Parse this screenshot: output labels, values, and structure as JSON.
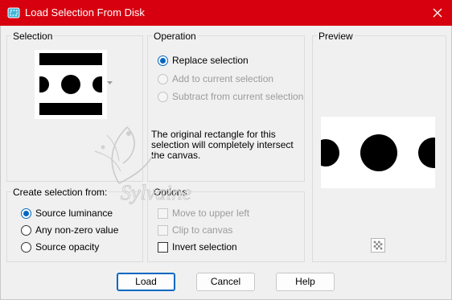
{
  "window": {
    "title": "Load Selection From Disk"
  },
  "selection": {
    "label": "Selection"
  },
  "operation": {
    "label": "Operation",
    "options": [
      {
        "label": "Replace selection",
        "checked": true,
        "disabled": false
      },
      {
        "label": "Add to current selection",
        "checked": false,
        "disabled": true
      },
      {
        "label": "Subtract from current selection",
        "checked": false,
        "disabled": true
      }
    ],
    "note": "The original rectangle for this selection will completely intersect the canvas."
  },
  "create_from": {
    "label": "Create selection from:",
    "options": [
      {
        "label": "Source luminance",
        "checked": true
      },
      {
        "label": "Any non-zero value",
        "checked": false
      },
      {
        "label": "Source opacity",
        "checked": false
      }
    ]
  },
  "options_group": {
    "label": "Options",
    "items": [
      {
        "label": "Move to upper left",
        "checked": false,
        "disabled": true
      },
      {
        "label": "Clip to canvas",
        "checked": false,
        "disabled": true
      },
      {
        "label": "Invert selection",
        "checked": false,
        "disabled": false
      }
    ]
  },
  "preview": {
    "label": "Preview"
  },
  "watermark": {
    "text": "Sylvaine"
  },
  "buttons": {
    "load": "Load",
    "cancel": "Cancel",
    "help": "Help"
  },
  "colors": {
    "titlebar": "#d7000f",
    "accent": "#0067c0"
  },
  "icons": {
    "app": "selection-app-icon",
    "close": "close-icon",
    "transparency": "checkerboard-icon"
  }
}
